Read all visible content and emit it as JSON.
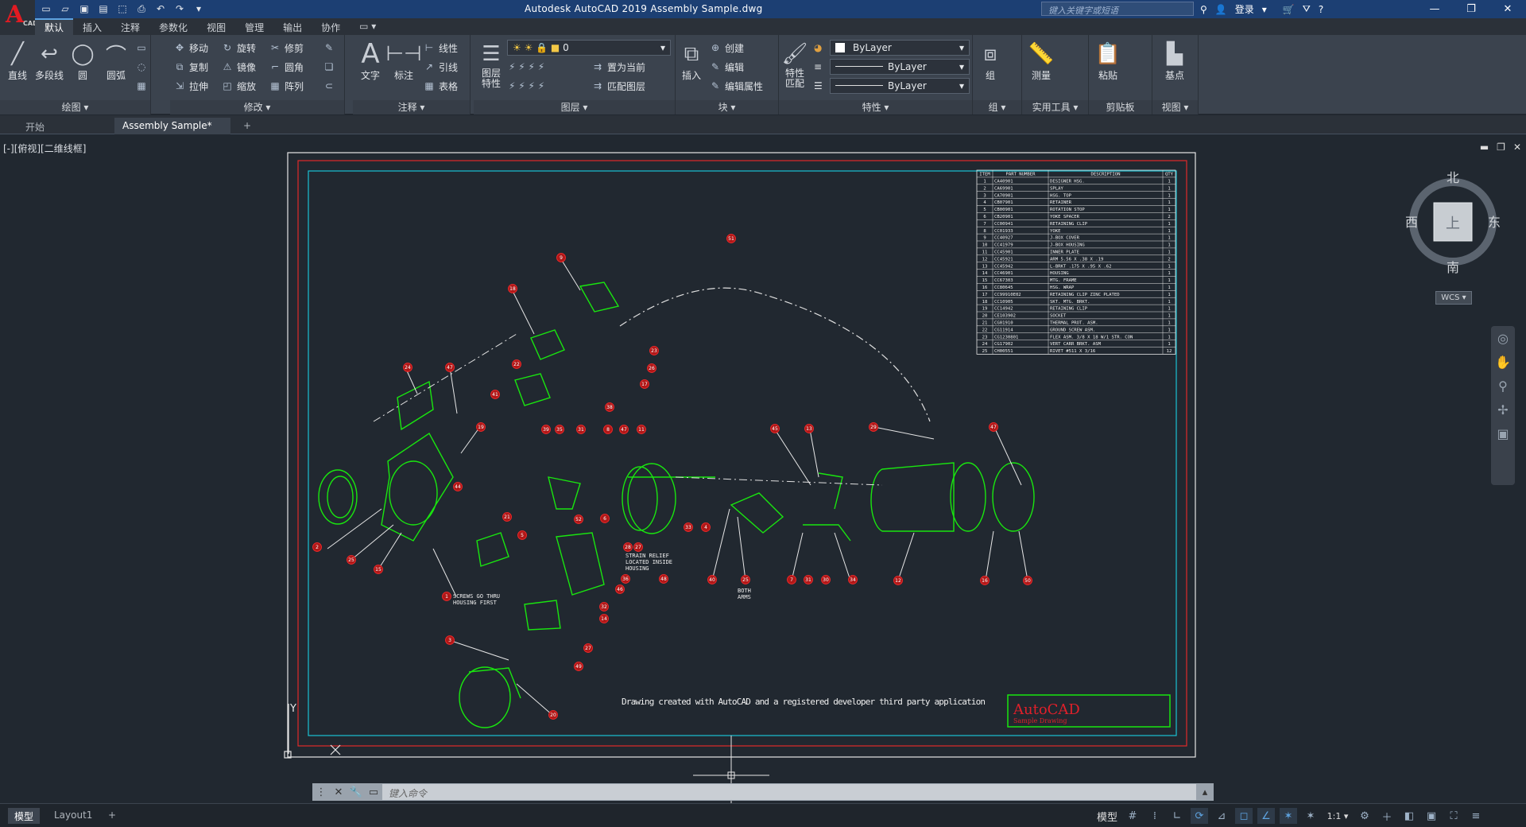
{
  "app": {
    "logo": "A",
    "logo_sub": "CAD",
    "title": "Autodesk AutoCAD 2019    Assembly Sample.dwg",
    "search_placeholder": "键入关键字或短语",
    "signin": "登录",
    "window_controls": [
      "—",
      "❐",
      "✕"
    ]
  },
  "qat": [
    "new-icon",
    "open-icon",
    "save-icon",
    "save-as-icon",
    "web-icon",
    "print-icon",
    "undo-icon",
    "redo-icon",
    "dropdown-icon"
  ],
  "ribbon_tabs": [
    "默认",
    "插入",
    "注释",
    "参数化",
    "视图",
    "管理",
    "输出",
    "协作",
    "▭ ▾"
  ],
  "ribbon": {
    "draw": {
      "title": "绘图 ▾",
      "line": "直线",
      "polyline": "多段线",
      "circle": "圆",
      "arc": "圆弧"
    },
    "modify": {
      "title": "修改 ▾",
      "move": "移动",
      "rotate": "旋转",
      "trim": "修剪",
      "copy": "复制",
      "mirror": "镜像",
      "fillet": "圆角",
      "stretch": "拉伸",
      "scale": "缩放",
      "array": "阵列"
    },
    "annotation": {
      "title": "注释 ▾",
      "text": "文字",
      "dimension": "标注",
      "linear": "线性",
      "leader": "引线",
      "table": "表格"
    },
    "layers": {
      "title": "图层 ▾",
      "layer_props": "图层\n特性",
      "layer_value": "0",
      "set_current": "置为当前",
      "match_layer": "匹配图层"
    },
    "block": {
      "title": "块 ▾",
      "insert": "插入",
      "create": "创建",
      "edit": "编辑",
      "edit_attr": "编辑属性"
    },
    "properties": {
      "title": "特性 ▾",
      "match": "特性\n匹配",
      "color": "ByLayer",
      "linetype": "ByLayer",
      "lineweight": "ByLayer"
    },
    "groups": {
      "title": "组 ▾",
      "group": "组"
    },
    "utilities": {
      "title": "实用工具 ▾",
      "measure": "测量"
    },
    "clipboard": {
      "title": "剪贴板",
      "paste": "粘贴"
    },
    "view": {
      "title": "视图 ▾",
      "base": "基点"
    }
  },
  "doc_tabs": [
    "开始",
    "Assembly Sample*",
    "+"
  ],
  "viewport_label": "[-][俯视][二维线框]",
  "viewcube": {
    "north": "北",
    "south": "南",
    "east": "东",
    "west": "西",
    "top": "上",
    "wcs": "WCS ▾"
  },
  "drawing": {
    "note": "Drawing created with AutoCAD and a registered developer third party application",
    "logo_title": "AutoCAD",
    "logo_sub": "Sample Drawing",
    "callout_screws": "SCREWS GO THRU\nHOUSING FIRST",
    "callout_strain": "STRAIN RELIEF\nLOCATED INSIDE\nHOUSING",
    "callout_both": "BOTH\nARMS",
    "bom_headers": [
      "ITEM",
      "PART NUMBER",
      "DESCRIPTION",
      "QTY"
    ],
    "bom": [
      [
        "1",
        "CA40901",
        "DESIGNER HSG.",
        "1"
      ],
      [
        "2",
        "CA69901",
        "SPLAY",
        "1"
      ],
      [
        "3",
        "CA70901",
        "HSG. TOP",
        "1"
      ],
      [
        "4",
        "CB07901",
        "RETAINER",
        "1"
      ],
      [
        "5",
        "CB00901",
        "ROTATION STOP",
        "1"
      ],
      [
        "6",
        "CB20901",
        "YOKE SPACER",
        "2"
      ],
      [
        "7",
        "CC00941",
        "RETAINING CLIP",
        "1"
      ],
      [
        "8",
        "CC01933",
        "YOKE",
        "1"
      ],
      [
        "9",
        "CC40927",
        "J-BOX COVER",
        "1"
      ],
      [
        "10",
        "CC41979",
        "J-BOX HOUSING",
        "1"
      ],
      [
        "11",
        "CC45901",
        "INNER PLATE",
        "1"
      ],
      [
        "12",
        "CC45921",
        "ARM 5.56 X .38 X .19",
        "2"
      ],
      [
        "13",
        "CC45942",
        "L-BRKT .175 X .95 X .62",
        "1"
      ],
      [
        "14",
        "CC46901",
        "HOUSING",
        "1"
      ],
      [
        "15",
        "CC67303",
        "MTG. FRAME",
        "1"
      ],
      [
        "16",
        "CC80645",
        "HSG. WRAP",
        "1"
      ],
      [
        "17",
        "CC99910E02",
        "RETAINING CLIP ZINC PLATED",
        "1"
      ],
      [
        "18",
        "CC10905",
        "SKT. MTG. BRKT.",
        "1"
      ],
      [
        "19",
        "CC14942",
        "RETAINING CLIP",
        "1"
      ],
      [
        "20",
        "CE103902",
        "SOCKET",
        "1"
      ],
      [
        "21",
        "CG01910",
        "THERMAL PROT. ASM.",
        "1"
      ],
      [
        "22",
        "CG11914",
        "GROUND SCREW ASM.",
        "1"
      ],
      [
        "23",
        "CG1230801",
        "FLEX ASM. 3/8 X 18 W/1 STR. CON",
        "1"
      ],
      [
        "24",
        "CG17902",
        "VERT CARR BRKT. ASM",
        "1"
      ],
      [
        "25",
        "CH00551",
        "RIVET #511 X 3/16",
        "12"
      ]
    ],
    "balloons": [
      "9",
      "18",
      "23",
      "26",
      "22",
      "17",
      "41",
      "38",
      "24",
      "47",
      "19",
      "44",
      "21",
      "39",
      "35",
      "31",
      "8",
      "47",
      "11",
      "45",
      "13",
      "29",
      "47",
      "2",
      "25",
      "15",
      "5",
      "52",
      "6",
      "33",
      "4",
      "28",
      "27",
      "36",
      "46",
      "32",
      "14",
      "48",
      "40",
      "25",
      "7",
      "31",
      "30",
      "34",
      "12",
      "16",
      "50",
      "3",
      "27",
      "49",
      "20",
      "1",
      "51"
    ]
  },
  "command": {
    "placeholder": "键入命令"
  },
  "status": {
    "tabs": [
      "模型",
      "Layout1",
      "+"
    ],
    "model_label": "模型",
    "scale": "1:1 ▾"
  }
}
